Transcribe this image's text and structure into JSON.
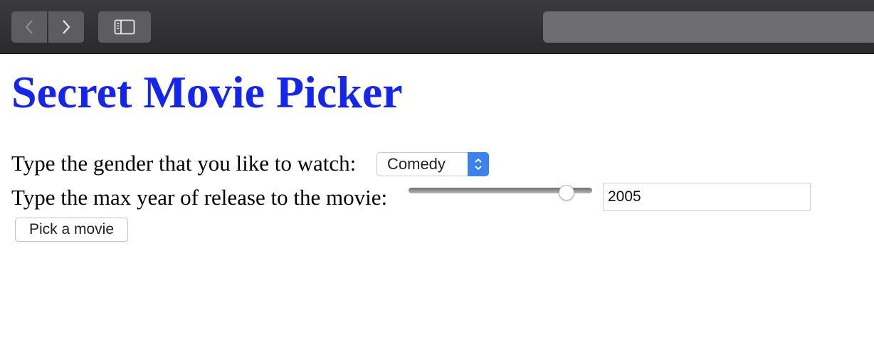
{
  "browser": {
    "back_icon": "chevron-left-icon",
    "forward_icon": "chevron-right-icon",
    "sidebar_icon": "sidebar-icon",
    "address_value": ""
  },
  "page": {
    "title": "Secret Movie Picker",
    "title_color": "#1424f5"
  },
  "form": {
    "genre_label": "Type the gender that you like to watch:",
    "genre_selected": "Comedy",
    "year_label": "Type the max year of release to the movie:",
    "slider_fraction": 0.86,
    "year_value": "2005",
    "submit_label": "Pick a movie"
  }
}
